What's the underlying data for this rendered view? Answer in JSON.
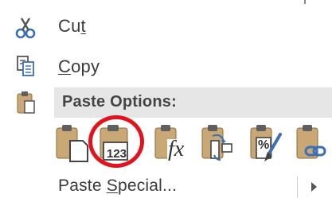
{
  "menu": {
    "cut": {
      "prefix": "Cu",
      "accel": "t",
      "icon": "scissors-icon"
    },
    "copy": {
      "accel": "C",
      "rest": "opy",
      "icon": "copy-icon"
    },
    "paste_options": {
      "label": "Paste Options:",
      "icon": "clipboard-icon"
    },
    "paste_buttons": [
      {
        "name": "keep-source-formatting",
        "icon": "paste-keep-source-icon"
      },
      {
        "name": "paste-values",
        "icon": "paste-values-icon",
        "text": "123",
        "highlighted": true
      },
      {
        "name": "paste-formulas",
        "icon": "paste-formulas-icon",
        "text": "fx"
      },
      {
        "name": "transpose",
        "icon": "paste-transpose-icon"
      },
      {
        "name": "paste-formatting",
        "icon": "paste-formatting-icon",
        "text": "%"
      },
      {
        "name": "paste-link",
        "icon": "paste-link-icon"
      }
    ],
    "paste_special": {
      "prefix": "Paste ",
      "accel": "S",
      "rest": "pecial..."
    }
  },
  "colors": {
    "highlight_circle": "#e3121d",
    "header_bg": "#e6e6e6",
    "clipboard_tan": "#c9a876",
    "clipboard_clip": "#5f5f5f"
  }
}
